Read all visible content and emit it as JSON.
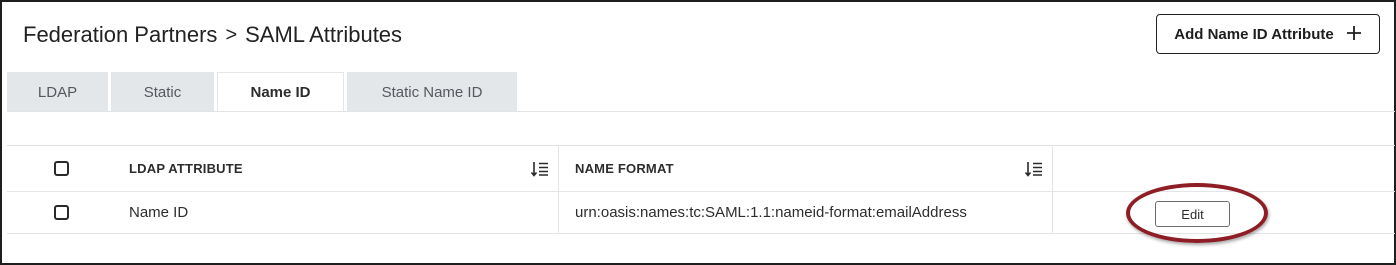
{
  "breadcrumb": {
    "parent": "Federation Partners",
    "separator": ">",
    "current": "SAML Attributes"
  },
  "toolbar": {
    "add_label": "Add Name ID Attribute",
    "add_icon": "plus-icon"
  },
  "tabs": [
    {
      "label": "LDAP",
      "active": false
    },
    {
      "label": "Static",
      "active": false
    },
    {
      "label": "Name ID",
      "active": true
    },
    {
      "label": "Static Name ID",
      "active": false
    }
  ],
  "table": {
    "columns": [
      {
        "label": "LDAP ATTRIBUTE",
        "sortable": true,
        "icon": "sort-icon"
      },
      {
        "label": "NAME FORMAT",
        "sortable": true,
        "icon": "sort-icon"
      }
    ],
    "rows": [
      {
        "ldap_attribute": "Name ID",
        "name_format": "urn:oasis:names:tc:SAML:1.1:nameid-format:emailAddress",
        "action_label": "Edit"
      }
    ]
  },
  "annotation": {
    "color": "#8e1e25",
    "target": "Edit"
  }
}
